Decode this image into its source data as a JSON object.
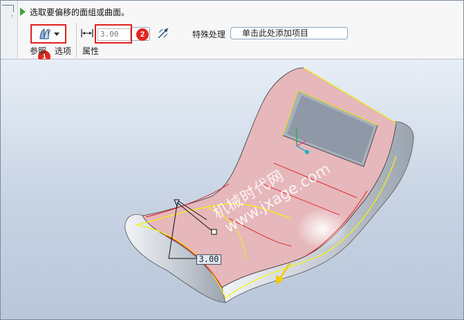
{
  "dashboard": {
    "message": "选取要偏移的面组或曲面。",
    "offset_value": "3.00",
    "special_label": "特殊处理",
    "special_field": "单击此处添加项目",
    "tabs": [
      "参照",
      "选项",
      "属性"
    ],
    "badges": [
      "1",
      "2"
    ],
    "icons": [
      "arrow-right-icon",
      "offset-surface-icon",
      "dropdown-arrow-icon",
      "offset-dimension-icon",
      "flip-direction-icon"
    ]
  },
  "viewport": {
    "watermark_line1": "机械时代网",
    "watermark_line2": "www.jxage.com",
    "dimension_label": "3.00"
  },
  "colors": {
    "accent_red": "#e02020",
    "surface_pink": "#e6b7bb",
    "edge_yellow": "#f5f500",
    "edge_red": "#e01818",
    "arrow_yellow": "#f2c800"
  }
}
